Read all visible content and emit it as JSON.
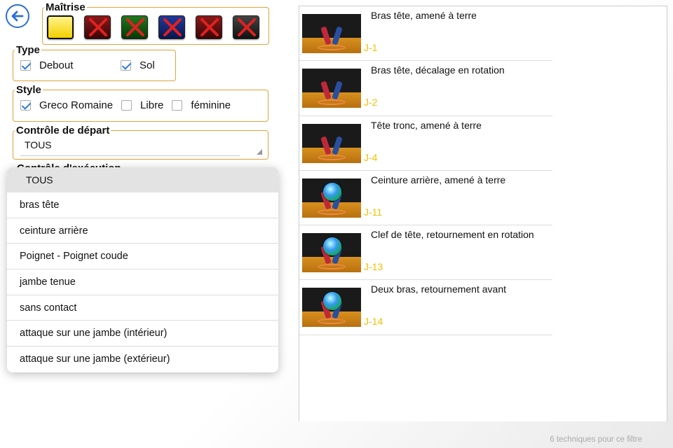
{
  "colors": {
    "accent": "#2a6fd6",
    "group_border": "#e1a23a",
    "code": "#f2c200"
  },
  "back_button": {
    "icon": "arrow-left-icon"
  },
  "mastery": {
    "label": "Maîtrise",
    "levels": [
      {
        "state": "active",
        "color": "yellow"
      },
      {
        "state": "crossed",
        "color": "red"
      },
      {
        "state": "crossed",
        "color": "green"
      },
      {
        "state": "crossed",
        "color": "blue"
      },
      {
        "state": "crossed",
        "color": "red"
      },
      {
        "state": "crossed",
        "color": "black"
      }
    ]
  },
  "type_group": {
    "label": "Type",
    "options": [
      {
        "label": "Debout",
        "checked": true
      },
      {
        "label": "Sol",
        "checked": true
      }
    ]
  },
  "style_group": {
    "label": "Style",
    "options": [
      {
        "label": "Greco Romaine",
        "checked": true
      },
      {
        "label": "Libre",
        "checked": false
      },
      {
        "label": "féminine",
        "checked": false
      }
    ]
  },
  "controle_depart": {
    "label": "Contrôle de départ",
    "value": "TOUS"
  },
  "controle_execution": {
    "label": "Contrôle d'exécution"
  },
  "dropdown": {
    "header": "TOUS",
    "items": [
      "bras tête",
      "ceinture arrière",
      "Poignet - Poignet coude",
      "jambe tenue",
      "sans contact",
      "attaque sur une jambe (intérieur)",
      "attaque sur une jambe (extérieur)"
    ]
  },
  "techniques": [
    {
      "title": "Bras tête, amené à terre",
      "code": "J-1",
      "overlay": false
    },
    {
      "title": "Bras tête, décalage en rotation",
      "code": "J-2",
      "overlay": false
    },
    {
      "title": "Tête tronc, amené à terre",
      "code": "J-4",
      "overlay": false
    },
    {
      "title": "Ceinture arrière, amené à terre",
      "code": "J-11",
      "overlay": true
    },
    {
      "title": "Clef de tête, retournement en rotation",
      "code": "J-13",
      "overlay": true
    },
    {
      "title": "Deux bras, retournement avant",
      "code": "J-14",
      "overlay": true
    }
  ],
  "footer": {
    "count_text": "6 techniques pour ce filtre"
  }
}
